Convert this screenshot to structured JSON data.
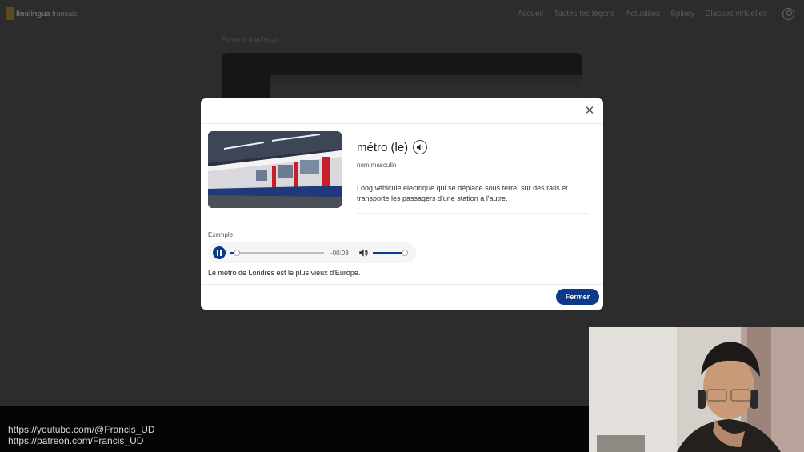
{
  "brand": {
    "logo_name": "linulingua",
    "logo_suffix": "francais"
  },
  "nav": {
    "items": [
      {
        "label": "Accueil"
      },
      {
        "label": "Toutes les leçons"
      },
      {
        "label": "Actualités"
      },
      {
        "label": "Spikey"
      },
      {
        "label": "Classes virtuelles"
      }
    ]
  },
  "page": {
    "back_link": "Revenir à la leçon"
  },
  "modal": {
    "word": "métro (le)",
    "grammar": "nom masculin",
    "definition": "Long véhicule électrique qui se déplace sous terre, sur des rails et transporte les passagers d'une station à l'autre.",
    "example_label": "Exemple",
    "example_sentence": "Le métro de Londres est le plus vieux d'Europe.",
    "close_button": "Fermer",
    "player": {
      "time_remaining": "-00:03",
      "progress": 0.08,
      "volume": 0.9,
      "state": "playing"
    }
  },
  "overlay": {
    "youtube": "https://youtube.com/@Francis_UD",
    "patreon": "https://patreon.com/Francis_UD"
  },
  "colors": {
    "accent": "#0b3a8a",
    "backdrop": "#2c2c2c"
  }
}
